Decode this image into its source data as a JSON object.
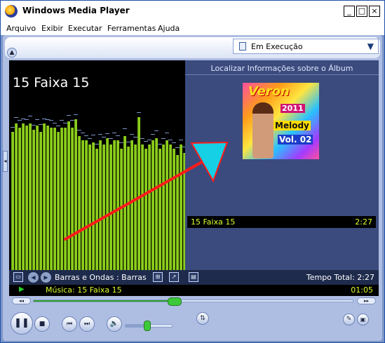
{
  "window": {
    "title": "Windows Media Player"
  },
  "titlebar_buttons": [
    "_",
    "□",
    "×"
  ],
  "menu": [
    "Arquivo",
    "Exibir",
    "Executar",
    "Ferramentas",
    "Ajuda"
  ],
  "now_playing_dropdown": {
    "icon": "now-playing-icon",
    "label": "Em Execução",
    "arrow": "▼"
  },
  "visualization": {
    "track_title": "15 Faixa 15",
    "style": "Barras e Ondas : Barras"
  },
  "spectrum": {
    "color": "#8ccc1b",
    "levels": [
      0.66,
      0.7,
      0.68,
      0.7,
      0.69,
      0.7,
      0.67,
      0.69,
      0.66,
      0.7,
      0.69,
      0.68,
      0.68,
      0.66,
      0.68,
      0.68,
      0.71,
      0.68,
      0.72,
      0.64,
      0.62,
      0.62,
      0.6,
      0.61,
      0.58,
      0.62,
      0.6,
      0.63,
      0.6,
      0.62,
      0.62,
      0.58,
      0.64,
      0.59,
      0.62,
      0.6,
      0.73,
      0.6,
      0.58,
      0.6,
      0.62,
      0.63,
      0.58,
      0.6,
      0.62,
      0.6,
      0.58,
      0.55,
      0.6,
      0.56
    ]
  },
  "media_info": {
    "header": "Localizar Informações sobre o Álbum"
  },
  "album_art": {
    "brand": "Veron",
    "year": "2011",
    "line1": "Melody",
    "line2": "Vol. 02"
  },
  "playlist": [
    {
      "name": "15 Faixa 15",
      "duration": "2:27"
    }
  ],
  "total_time": "Tempo Total: 2:27",
  "status": {
    "play_icon": "▶",
    "label": "Música: 15 Faixa 15",
    "elapsed": "01:05"
  },
  "seek": {
    "position_fraction": 0.44,
    "rewind_label": "◂◂",
    "forward_label": "▸▸"
  },
  "volume": {
    "level_fraction": 0.45
  },
  "annotation": {
    "arrow_color": "#ff1a1a",
    "head_color": "#16d0e6"
  },
  "colors": {
    "window_frame": "#7b95c8",
    "panel_bg": "#3b4b7d",
    "status_text": "#d8ff2a",
    "play_green": "#27d12a"
  }
}
